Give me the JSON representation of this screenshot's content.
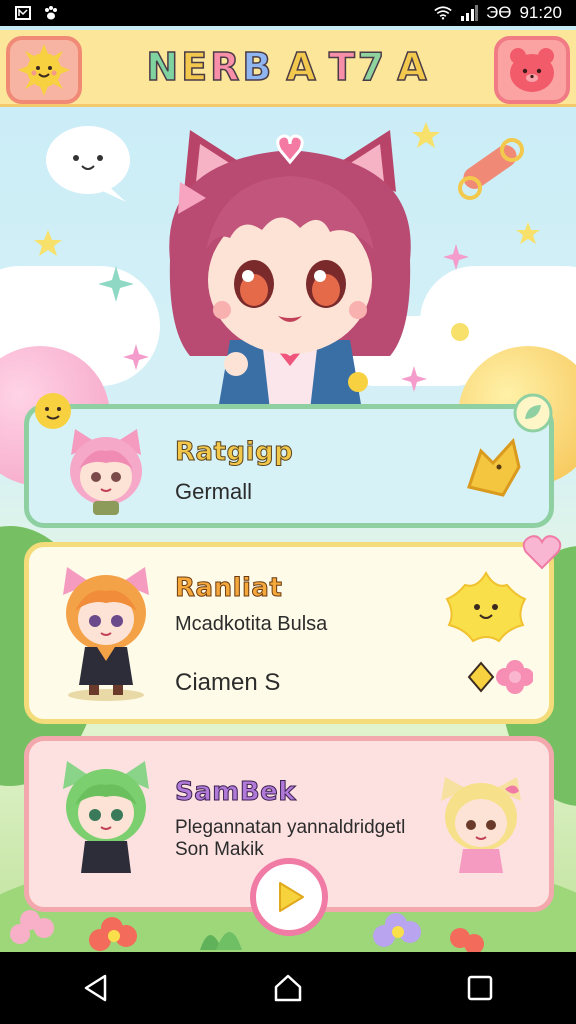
{
  "status_bar": {
    "time": "91:20",
    "network_label": "ЭӨ"
  },
  "header": {
    "title_letters": [
      "N",
      "E",
      "R",
      "B",
      "A",
      "T",
      "7",
      "A"
    ]
  },
  "cards": [
    {
      "name": "Ratgigp",
      "subtitle": "Germall"
    },
    {
      "name": "Ranliat",
      "subtitle": "Mcadkotita Bulsa",
      "detail": "Ciamen S"
    },
    {
      "name": "SamBek",
      "subtitle": "Plegannatan yannaldridgetl",
      "detail": "Son Makik"
    }
  ],
  "colors": {
    "title_colors": [
      "#7fd3a0",
      "#f3c94d",
      "#f78fa9",
      "#8fb6f0",
      "#f3c94d",
      "#f78fa9",
      "#8fd39f",
      "#f3c94d"
    ],
    "card1_name": "#f2c84b",
    "card2_name": "#f5a83b",
    "card3_name": "#b17ad9"
  },
  "icons": {
    "sun": "sun-icon",
    "bear": "bear-icon",
    "play": "play-icon"
  }
}
